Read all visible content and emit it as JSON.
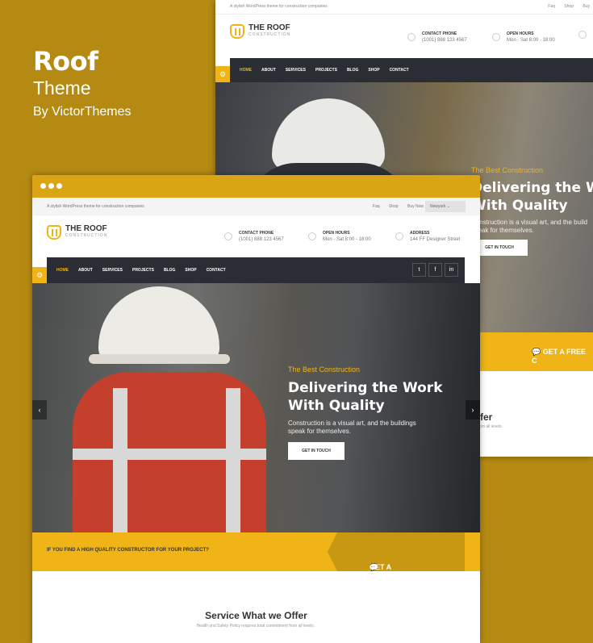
{
  "promo": {
    "brand": "Roof",
    "subtitle": "Theme",
    "byline": "By VictorThemes"
  },
  "back": {
    "topbar_text": "A stylish WordPress theme for construction companies",
    "top_links": [
      "Faq",
      "Shop",
      "Buy"
    ],
    "logo_title": "THE ROOF",
    "logo_sub": "CONSTRUCTION",
    "phone_label": "CONTACT PHONE",
    "phone_value": "(1001) 888 123 4567",
    "hours_label": "OPEN HOURS",
    "hours_value": "Mon - Sat 8:00 - 18:00",
    "nav": [
      "HOME",
      "ABOUT",
      "SERVICES",
      "PROJECTS",
      "BLOG",
      "SHOP",
      "CONTACT"
    ],
    "hero_tag": "The Best Construction",
    "hero_h1_line1": "Delivering the W",
    "hero_h1_line2": "With Quality",
    "hero_p1": "Construction is a visual art, and the build",
    "hero_p2": "speak for themselves.",
    "hero_button": "GET IN TOUCH",
    "cta_right": "GET A FREE C",
    "offer_title": "ffer",
    "offer_sub": "from all levels ."
  },
  "front": {
    "topbar_text": "A stylish WordPress theme for construction companies",
    "top_links": [
      "Faq",
      "Shop",
      "Buy Now"
    ],
    "city": "Newyork",
    "logo_title": "THE ROOF",
    "logo_sub": "CONSTRUCTION",
    "phone_label": "CONTACT PHONE",
    "phone_value": "(1001) 888 123 4567",
    "hours_label": "OPEN HOURS",
    "hours_value": "Mon - Sat 8:00 - 18:00",
    "address_label": "ADDRESS",
    "address_value": "144 FF Designer Street",
    "nav": [
      "HOME",
      "ABOUT",
      "SERVICES",
      "PROJECTS",
      "BLOG",
      "SHOP",
      "CONTACT"
    ],
    "social": [
      "twitter-icon",
      "facebook-icon",
      "linkedin-icon"
    ],
    "hero_tag": "The Best Construction",
    "hero_h1_line1": "Delivering the Work",
    "hero_h1_line2": "With Quality",
    "hero_p1": "Construction is a visual art, and the buildings",
    "hero_p2": "speak for themselves.",
    "hero_button": "GET IN TOUCH",
    "cta_left": "IF YOU FIND A HIGH QUALITY CONSTRUCTOR FOR YOUR PROJECT?",
    "cta_right": "GET A FREE CONSULT",
    "offer_title": "Service What we Offer",
    "offer_sub": "Health and Safety Policy requires total commitment from all levels ."
  },
  "colors": {
    "background": "#b58a12",
    "accent": "#f0b417",
    "nav_dark": "#2a2d34"
  }
}
